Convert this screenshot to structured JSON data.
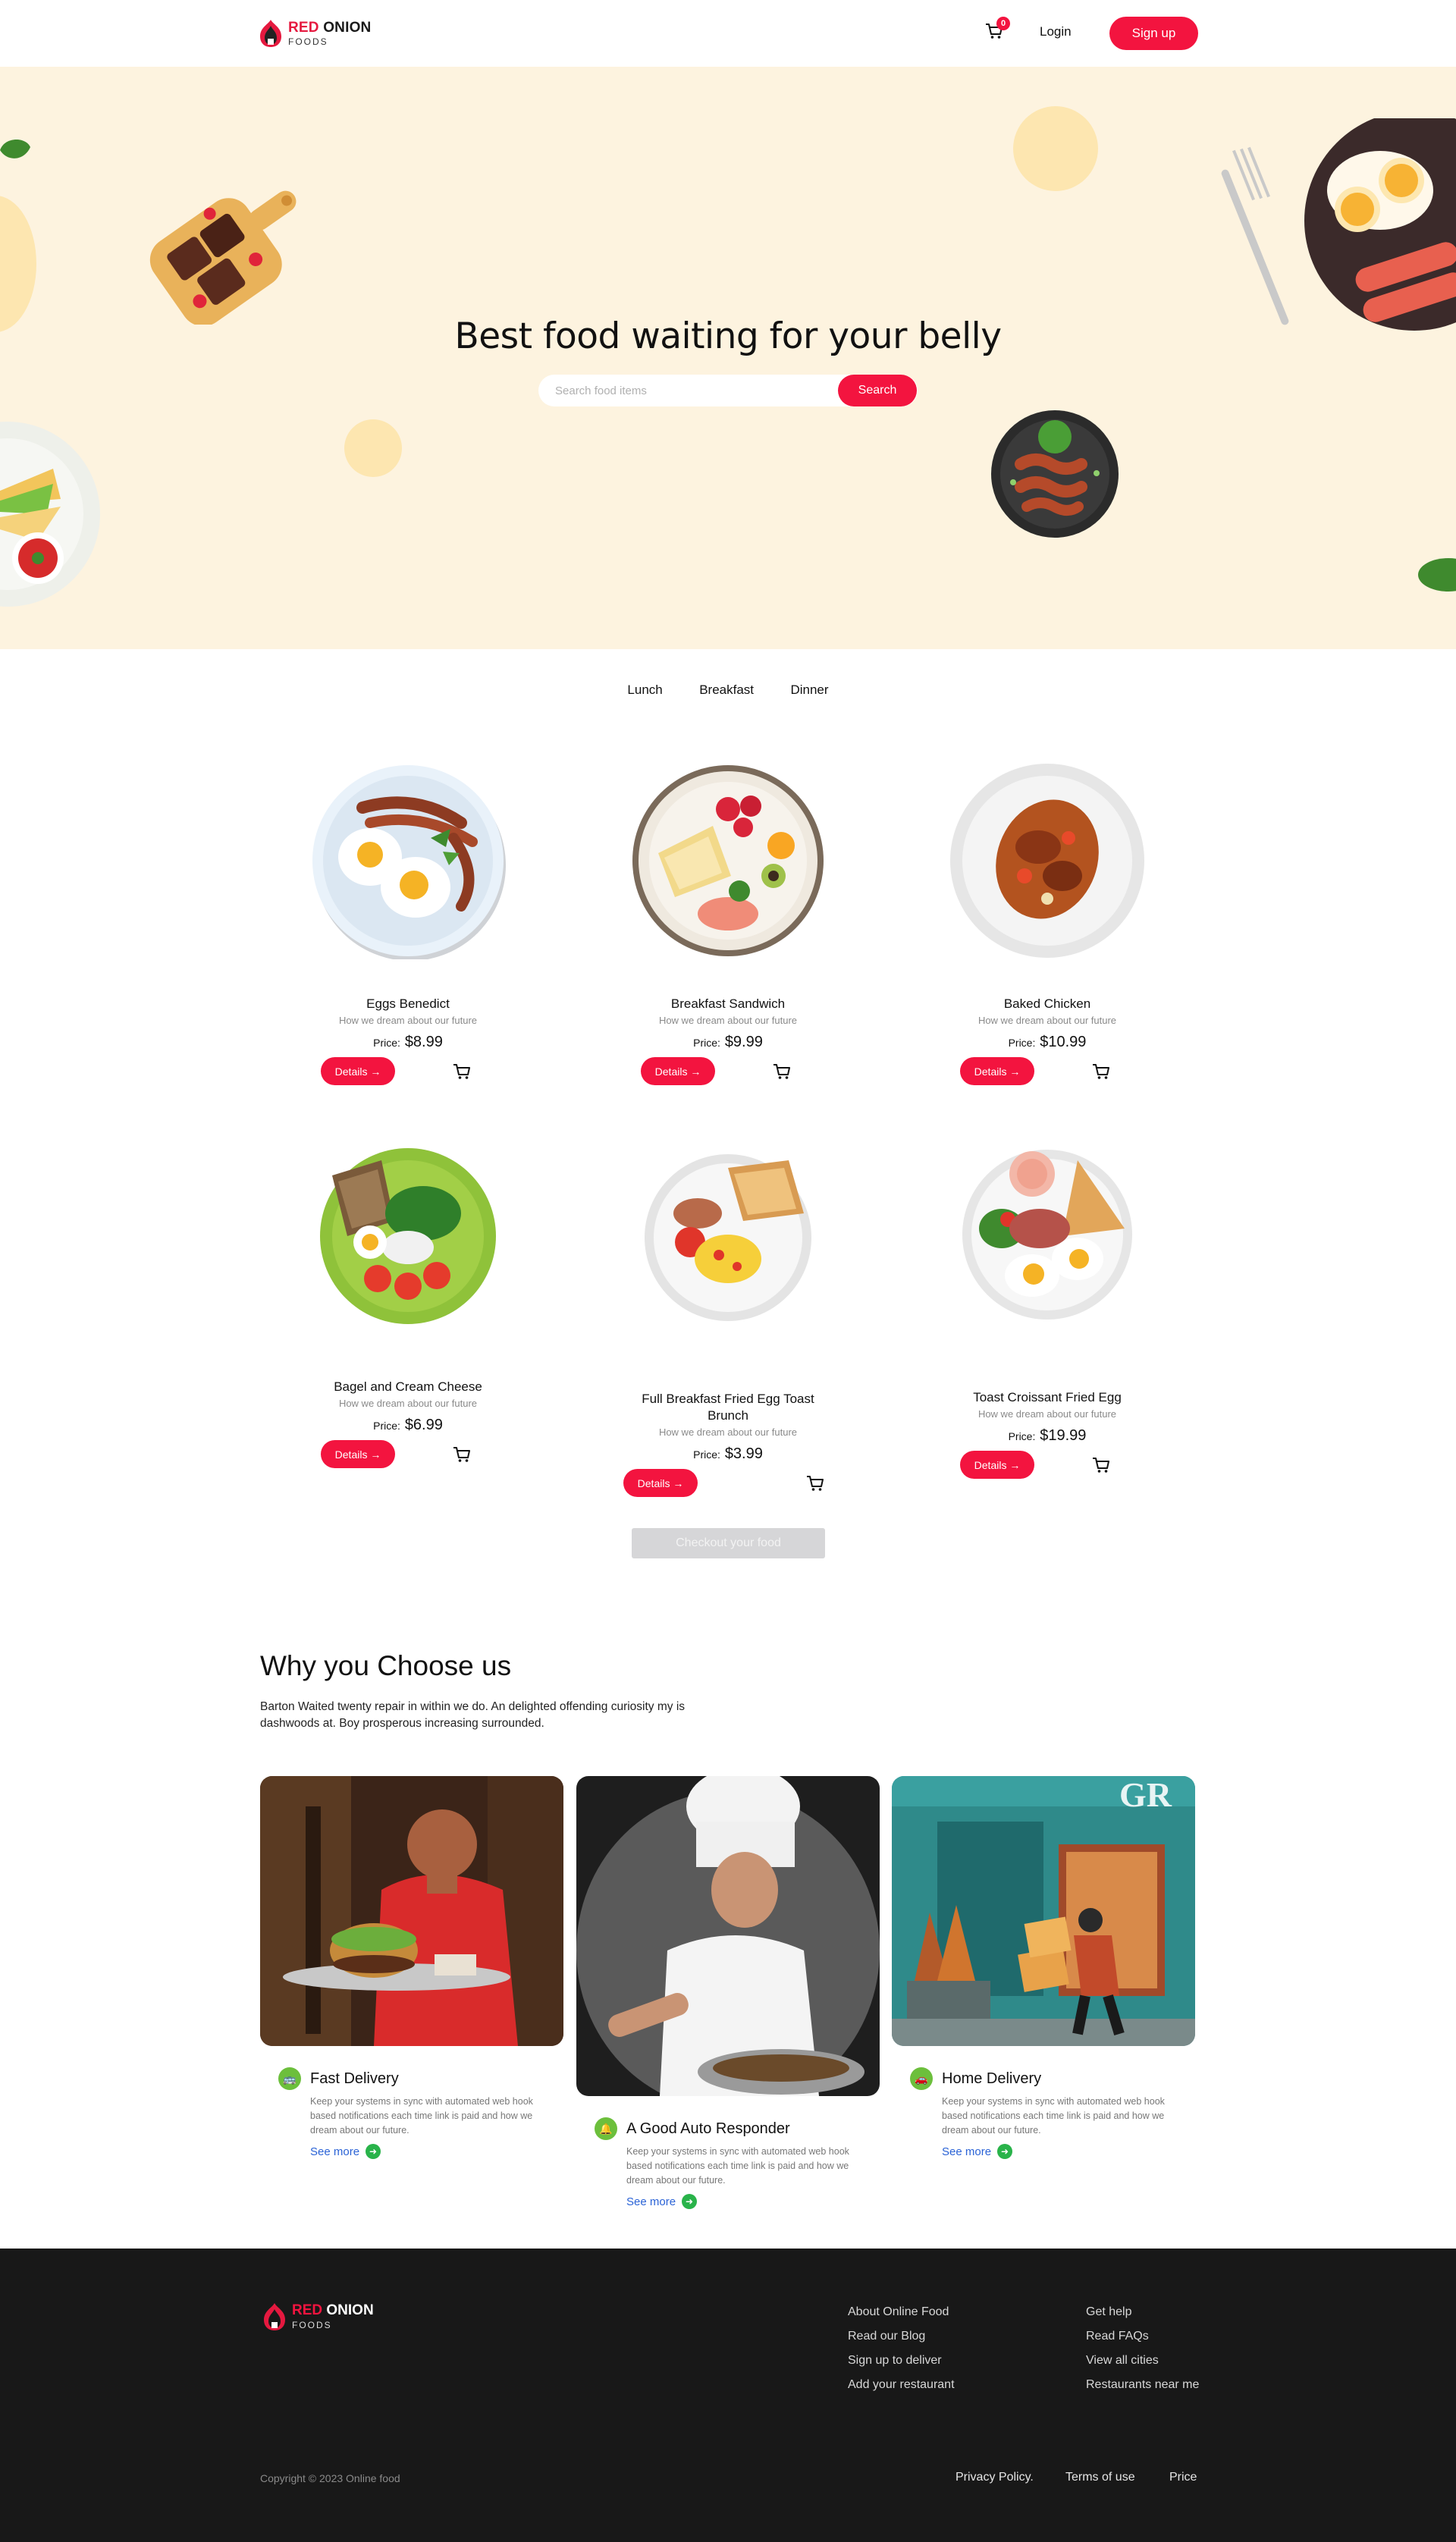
{
  "brand": {
    "name_red": "RED",
    "name_rest": " ONION",
    "tagline": "FOODS"
  },
  "nav": {
    "cart_count": "0",
    "login_label": "Login",
    "signup_label": "Sign up",
    "cart_icon": "cart-icon"
  },
  "hero": {
    "title": "Best food waiting for your belly",
    "search_placeholder": "Search food items",
    "search_label": "Search"
  },
  "tabs": [
    "Lunch",
    "Breakfast",
    "Dinner"
  ],
  "menu": {
    "price_prefix": "Price:",
    "details_label": "Details →",
    "items": [
      {
        "name": "Eggs Benedict",
        "desc": "How we dream about our future",
        "price": "$8.99"
      },
      {
        "name": "Breakfast Sandwich",
        "desc": "How we dream about our future",
        "price": "$9.99"
      },
      {
        "name": "Baked Chicken",
        "desc": "How we dream about our future",
        "price": "$10.99"
      },
      {
        "name": "Bagel and Cream Cheese",
        "desc": "How we dream about our future",
        "price": "$6.99"
      },
      {
        "name": "Full Breakfast Fried Egg Toast Brunch",
        "desc": "How we dream about our future",
        "price": "$3.99"
      },
      {
        "name": "Toast Croissant Fried Egg",
        "desc": "How we dream about our future",
        "price": "$19.99"
      }
    ],
    "checkout_label": "Checkout your food"
  },
  "why": {
    "title": "Why you Choose us",
    "subtitle": "Barton Waited twenty repair in within we do. An delighted offending curiosity my is dashwoods at. Boy prosperous increasing surrounded.",
    "features": [
      {
        "title": "Fast Delivery",
        "text": "Keep your systems in sync with automated web hook based notifications each time link is paid and how we dream about our future.",
        "more": "See more",
        "icon": "bus-icon"
      },
      {
        "title": "A Good Auto Responder",
        "text": "Keep your systems in sync with automated web hook based notifications each time link is paid and how we dream about our future.",
        "more": "See more",
        "icon": "bell-icon"
      },
      {
        "title": "Home Delivery",
        "text": "Keep your systems in sync with automated web hook based notifications each time link is paid and how we dream about our future.",
        "more": "See more",
        "icon": "car-icon"
      }
    ],
    "storefront_sign": "GR"
  },
  "footer": {
    "col1": [
      "About Online Food",
      "Read our Blog",
      "Sign up to deliver",
      "Add your restaurant"
    ],
    "col2": [
      "Get help",
      "Read FAQs",
      "View all cities",
      "Restaurants near me"
    ],
    "copyright": "Copyright © 2023 Online food",
    "bottom_links": [
      "Privacy Policy.",
      "Terms of use",
      "Price"
    ]
  },
  "colors": {
    "accent": "#f3143f",
    "hero_bg": "#fdf3df",
    "footer_bg": "#181818",
    "icon_green": "#6cbf3c",
    "link_blue": "#2b63d6"
  }
}
